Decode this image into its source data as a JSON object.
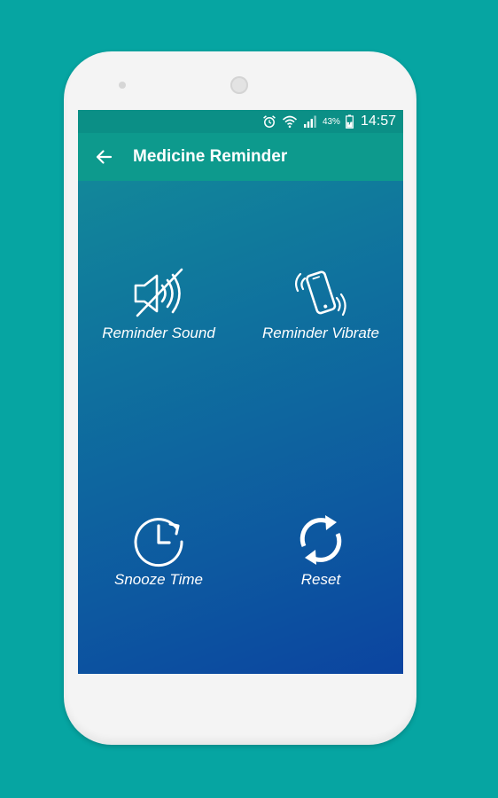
{
  "status_bar": {
    "battery_percent": "43%",
    "time": "14:57",
    "icons": [
      "alarm-icon",
      "wifi-icon",
      "signal-icon",
      "battery-icon"
    ]
  },
  "app_bar": {
    "title": "Medicine Reminder",
    "back_icon": "back-arrow-icon"
  },
  "options": [
    {
      "label": "Reminder Sound",
      "icon": "sound-off-icon"
    },
    {
      "label": "Reminder Vibrate",
      "icon": "vibrate-icon"
    },
    {
      "label": "Snooze Time",
      "icon": "clock-icon"
    },
    {
      "label": "Reset",
      "icon": "reset-icon"
    }
  ],
  "colors": {
    "background": "#06a5a2",
    "status_bar": "#0b8f86",
    "app_bar": "#0d9a8d",
    "gradient_top": "#138f98",
    "gradient_bottom": "#0b44a0"
  }
}
